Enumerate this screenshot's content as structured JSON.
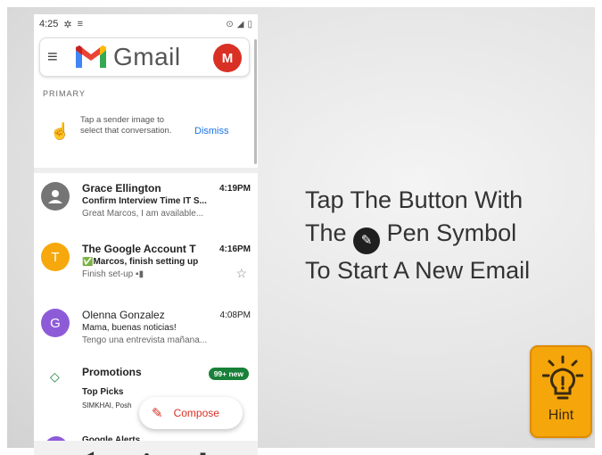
{
  "status_bar": {
    "time": "4:25"
  },
  "gmail": {
    "wordmark": "Gmail",
    "avatar_letter": "M"
  },
  "section_label": "PRIMARY",
  "tip": {
    "text": "Tap a sender image to select that conversation.",
    "dismiss": "Dismiss"
  },
  "emails": [
    {
      "avatar": "",
      "avatar_color": "#757575",
      "sender": "Grace Ellington",
      "time": "4:19PM",
      "subject": "Confirm Interview Time IT S...",
      "snippet": "Great Marcos, I am available...",
      "unread": true
    },
    {
      "avatar": "T",
      "avatar_color": "#f6a80d",
      "sender": "The Google Account T",
      "time": "4:16PM",
      "subject": "✅Marcos, finish setting up",
      "snippet": "Finish set-up ▪▮",
      "unread": true
    },
    {
      "avatar": "G",
      "avatar_color": "#8e5bd8",
      "sender": "Olenna Gonzalez",
      "time": "4:08PM",
      "subject": "Mama, buenas noticias!",
      "snippet": "Tengo una entrevista mañana...",
      "unread": false
    }
  ],
  "promotions": {
    "title": "Promotions",
    "badge": "99+ new",
    "line1": "Top Picks",
    "line2": "SIMKHAI, Posh"
  },
  "peek_sender": "Google Alerts",
  "compose_label": "Compose",
  "instruction": {
    "line1": "Tap The Button With",
    "line2a": "The",
    "line2b": "Pen Symbol",
    "line3": "To Start A New Email"
  },
  "hint_label": "Hint",
  "colors": {
    "gmail_red": "#d93025",
    "link_blue": "#1a73e8",
    "hint_orange": "#f5a60a",
    "promo_green": "#188038"
  }
}
